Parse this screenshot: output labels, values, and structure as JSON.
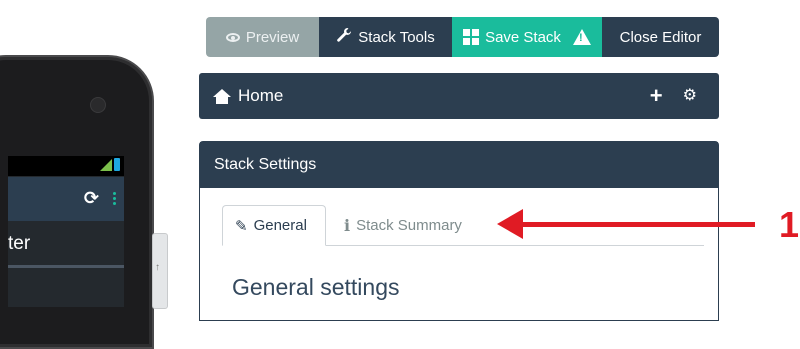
{
  "toolbar": {
    "preview_label": "Preview",
    "tools_label": "Stack Tools",
    "save_label": "Save Stack",
    "close_label": "Close Editor"
  },
  "navbar": {
    "home_label": "Home"
  },
  "panel": {
    "title": "Stack Settings",
    "tabs": [
      {
        "label": "General",
        "active": true
      },
      {
        "label": "Stack Summary",
        "active": false
      }
    ],
    "section_title": "General settings"
  },
  "phone": {
    "title_fragment": "ter",
    "scroll_glyph": "↑"
  },
  "annotation": {
    "callout_number": "1",
    "color": "#e01b24"
  },
  "colors": {
    "primary": "#2c3e50",
    "accent": "#1abc9c",
    "muted": "#95a5a6"
  },
  "icons": {
    "preview": "eye-icon",
    "tools": "wrench-icon",
    "save": "grid-icon",
    "warning": "warning-icon",
    "home": "home-icon",
    "add": "plus-icon",
    "settings": "cog-icon",
    "general_tab": "edit-icon",
    "summary_tab": "info-icon"
  }
}
